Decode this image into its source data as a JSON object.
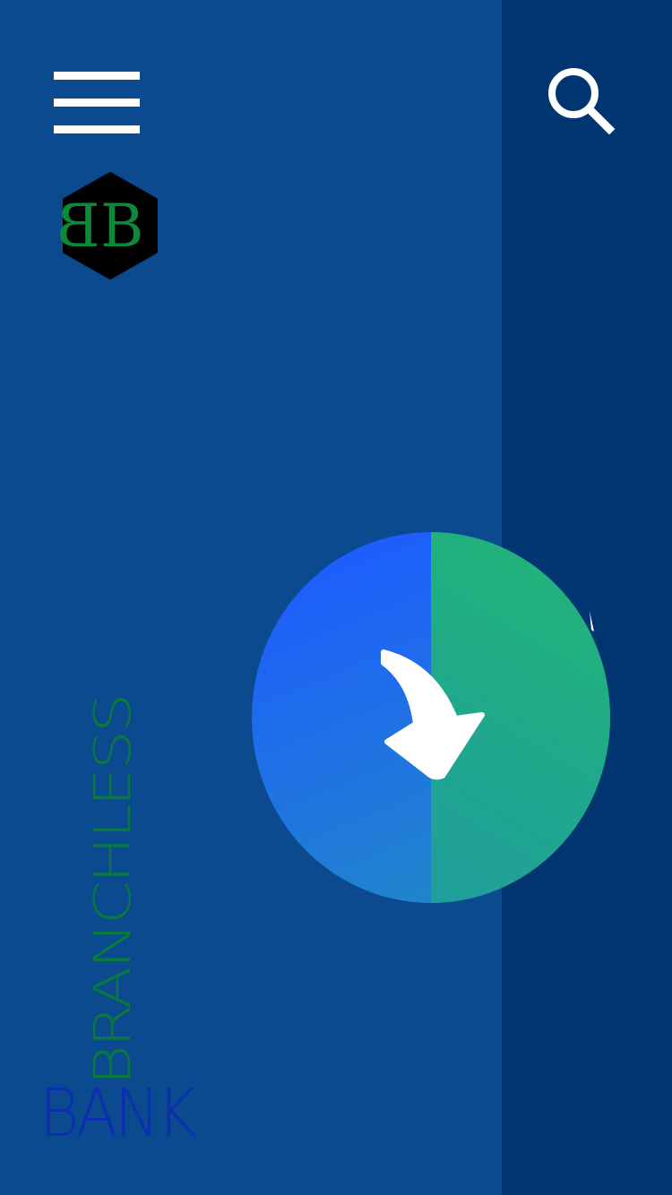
{
  "app": {
    "brand_line1": "BRANCHLESS",
    "brand_line2": "BANK",
    "logo_letters": "BB"
  },
  "header": {
    "menu_icon": "hamburger-menu-icon",
    "search_icon": "search-icon"
  },
  "dial": {
    "icon": "curved-arrow-down-icon",
    "progress_fraction": 0.5
  },
  "colors": {
    "background_left": "#0b4a8f",
    "background_right": "#003572",
    "dial_blue": "#1e5cff",
    "dial_green": "#22bd66",
    "brand_green": "#0a7a3a",
    "brand_blue": "#0b2fb0",
    "logo_green": "#0b8a3a"
  }
}
